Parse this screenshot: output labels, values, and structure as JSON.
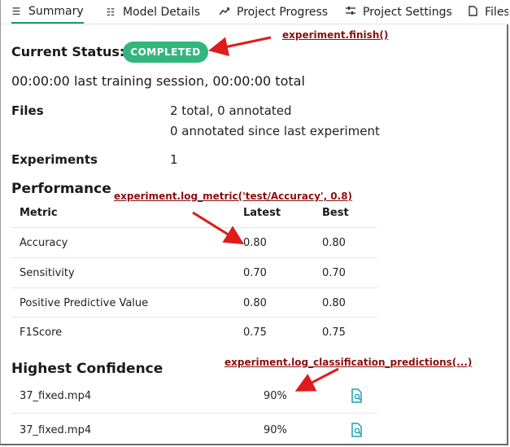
{
  "tabs": [
    {
      "icon": "list-icon",
      "label": "Summary",
      "active": true
    },
    {
      "icon": "model-icon",
      "label": "Model Details",
      "active": false
    },
    {
      "icon": "trend-icon",
      "label": "Project Progress",
      "active": false
    },
    {
      "icon": "sliders-icon",
      "label": "Project Settings",
      "active": false
    },
    {
      "icon": "file-icon",
      "label": "Files",
      "active": false
    }
  ],
  "status": {
    "label": "Current Status:",
    "badge": "COMPLETED",
    "badge_color": "#33b67d"
  },
  "session_text": "00:00:00 last training session, 00:00:00 total",
  "files": {
    "label": "Files",
    "line1": "2 total, 0 annotated",
    "line2": "0 annotated since last experiment"
  },
  "experiments": {
    "label": "Experiments",
    "value": "1"
  },
  "performance": {
    "title": "Performance",
    "headers": {
      "metric": "Metric",
      "latest": "Latest",
      "best": "Best"
    },
    "rows": [
      {
        "metric": "Accuracy",
        "latest": "0.80",
        "best": "0.80"
      },
      {
        "metric": "Sensitivity",
        "latest": "0.70",
        "best": "0.70"
      },
      {
        "metric": "Positive Predictive Value",
        "latest": "0.80",
        "best": "0.80"
      },
      {
        "metric": "F1Score",
        "latest": "0.75",
        "best": "0.75"
      }
    ]
  },
  "highest_confidence": {
    "title": "Highest Confidence",
    "rows": [
      {
        "file": "37_fixed.mp4",
        "confidence": "90%"
      },
      {
        "file": "37_fixed.mp4",
        "confidence": "90%"
      }
    ]
  },
  "annotations": {
    "finish": "experiment.finish()",
    "log_metric": "experiment.log_metric('test/Accuracy', 0.8)",
    "log_predictions": "experiment.log_classification_predictions(...)",
    "color": "#8b0f0f",
    "arrow_color": "#e01b1b"
  },
  "accent_color": "#1f9a63"
}
